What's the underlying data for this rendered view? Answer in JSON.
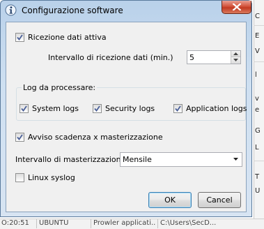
{
  "window": {
    "title": "Configurazione software"
  },
  "reception": {
    "enabled_label": "Ricezione dati attiva",
    "enabled_checked": true,
    "interval_label": "Intervallo di ricezione dati (min.)",
    "interval_value": "5"
  },
  "logs": {
    "group_title": "Log da processare:",
    "items": [
      {
        "label": "System logs",
        "checked": true
      },
      {
        "label": "Security logs",
        "checked": true
      },
      {
        "label": "Application logs",
        "checked": true
      }
    ]
  },
  "archiving": {
    "warning_label": "Avviso scadenza x masterizzazione",
    "warning_checked": true,
    "interval_label": "Intervallo di masterizzazione",
    "interval_value": "Mensile"
  },
  "syslog": {
    "label": "Linux syslog",
    "checked": false
  },
  "buttons": {
    "ok": "OK",
    "cancel": "Cancel"
  },
  "background": {
    "side_fragments": [
      "C",
      "E",
      "V",
      "l",
      "v",
      "e",
      "G",
      "L",
      "T",
      "U"
    ],
    "bottom_fragments": [
      "O:20:51",
      "UBUNTU",
      "Prowler applicati...",
      "C:\\Users\\SecD..."
    ]
  },
  "colors": {
    "check_mark": "#4a5f97",
    "title_bar": "#c6dbf0",
    "close_button": "#c7432a"
  }
}
